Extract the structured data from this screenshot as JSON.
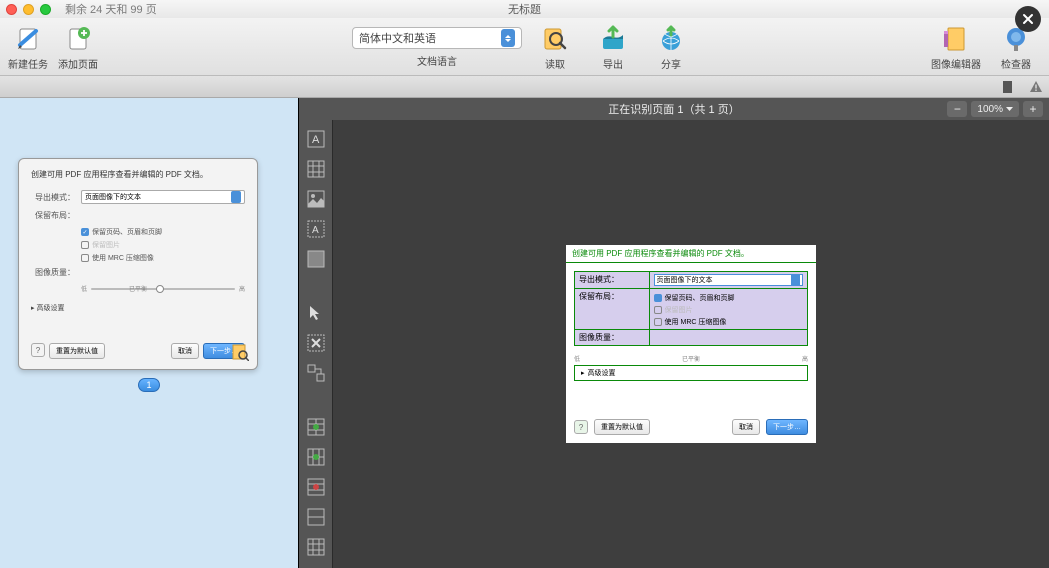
{
  "titlebar": {
    "trial_text": "剩余 24 天和 99 页",
    "window_title": "无标题"
  },
  "toolbar": {
    "new_task": "新建任务",
    "add_page": "添加页面",
    "doc_lang_label": "文档语言",
    "language_value": "简体中文和英语",
    "read": "读取",
    "export": "导出",
    "share": "分享",
    "image_editor": "图像编辑器",
    "inspector": "检查器"
  },
  "zoom": {
    "value": "100%"
  },
  "status": {
    "recognizing": "正在识别页面 1（共 1 页）"
  },
  "thumbnail": {
    "badge": "1",
    "dialog": {
      "title": "创建可用 PDF 应用程序查看并编辑的 PDF 文档。",
      "export_mode_label": "导出模式：",
      "export_mode_value": "页面图像下的文本",
      "keep_layout_label": "保留布局：",
      "check_headers": "保留页码、页眉和页脚",
      "check_keep_image": "保留图片",
      "check_mrc": "使用 MRC 压缩图像",
      "image_quality_label": "图像质量：",
      "slider_low": "低",
      "slider_balanced": "已平衡",
      "slider_high": "高",
      "advanced": "高级设置",
      "reset_defaults": "重置为默认值",
      "cancel": "取消",
      "next": "下一步…",
      "help": "?"
    }
  },
  "tool_icons": [
    "text-tool",
    "table-tool",
    "image-tool",
    "textbox-tool",
    "rect-tool",
    "pointer-tool",
    "selection-tool",
    "crop-tool",
    "delete-area",
    "add-vertical",
    "add-horizontal",
    "split-tool",
    "merge-tool"
  ],
  "ocr": {
    "title": "创建可用 PDF 应用程序查看并编辑的 PDF 文档。",
    "export_mode_label": "导出模式：",
    "export_mode_value": "页面图像下的文本",
    "keep_layout_label": "保留布局：",
    "check_headers": "保留页码、页眉和页脚",
    "check_keep_image": "保留图片",
    "check_mrc": "使用 MRC 压缩图像",
    "image_quality_label": "图像质量：",
    "slider_low": "低",
    "slider_balanced": "已平衡",
    "slider_high": "高",
    "advanced": "高级设置",
    "reset_defaults": "重置为默认值",
    "cancel": "取消",
    "next": "下一步…",
    "help": "?"
  }
}
